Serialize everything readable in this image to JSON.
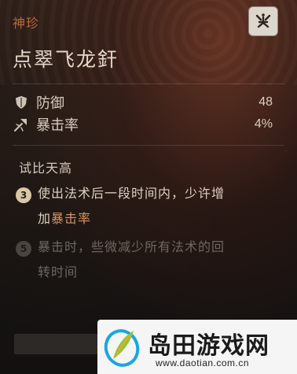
{
  "item": {
    "category": "神珍",
    "name": "点翠飞龙釬",
    "badge_icon": "curio-emblem-icon"
  },
  "stats": [
    {
      "icon": "shield-icon",
      "label": "防御",
      "value": "48"
    },
    {
      "icon": "crit-icon",
      "label": "暴击率",
      "value": "4%"
    }
  ],
  "set": {
    "title": "试比天高",
    "effects": [
      {
        "level": "3",
        "active": true,
        "line1": "使出法术后一段时间内，少许增",
        "line2_prefix": "加",
        "line2_highlight": "暴击率"
      },
      {
        "level": "5",
        "active": false,
        "line1": "暴击时，些微减少所有法术的回",
        "line2": "转时间"
      }
    ]
  },
  "watermark": {
    "title": "岛田游戏网",
    "url": "www.daotian.com.cn"
  },
  "colors": {
    "accent": "#b8683c",
    "highlight": "#d99060",
    "text": "#ddd2c2",
    "inactive": "#6e6762"
  }
}
